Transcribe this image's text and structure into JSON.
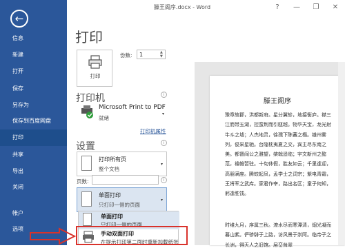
{
  "app": {
    "window_title": "滕王阁序.docx - Word"
  },
  "window_controls": {
    "help": "?",
    "minimize": "—",
    "restore": "❐",
    "close": "✕"
  },
  "sidebar": {
    "back_glyph": "←",
    "items": [
      {
        "label": "信息"
      },
      {
        "label": "新建"
      },
      {
        "label": "打开"
      },
      {
        "label": "保存"
      },
      {
        "label": "另存为"
      },
      {
        "label": "保存到百度网盘"
      },
      {
        "label": "打印"
      },
      {
        "label": "共享"
      },
      {
        "label": "导出"
      },
      {
        "label": "关闭"
      },
      {
        "label": "帐户"
      },
      {
        "label": "选项"
      }
    ],
    "active_index": 6
  },
  "print": {
    "heading": "打印",
    "print_button": "打印",
    "copies_label": "份数:",
    "copies_value": "1"
  },
  "printer": {
    "section_title": "打印机",
    "name": "Microsoft Print to PDF",
    "status": "就绪",
    "properties_link": "打印机属性",
    "info_glyph": "i"
  },
  "settings": {
    "section_title": "设置",
    "range_primary": "打印所有页",
    "range_secondary": "整个文档",
    "pages_label": "页数:",
    "pages_value": "",
    "sides_primary": "单面打印",
    "sides_secondary": "只打印一侧的页面",
    "caret": "▾",
    "info_glyph": "i"
  },
  "sides_menu": {
    "items": [
      {
        "primary": "单面打印",
        "secondary": "只打印一侧的页面"
      },
      {
        "primary": "手动双面打印",
        "secondary": "在提示打印第二面时重新加载纸张"
      }
    ]
  },
  "preview": {
    "title": "滕王阁序",
    "paragraphs": [
      "豫章故郡，洪都新府。星分翼轸，地接衡庐。襟三江而带五湖，控蛮荆而引瓯越。物华天宝，龙光射牛斗之墟；人杰地灵，徐孺下陈蕃之榻。雄州雾列，俊采星驰。台隍枕夷夏之交，宾主尽东南之美。都督阎公之雅望，棨戟遥临；宇文新州之懿范，襜帷暂驻。十旬休假，胜友如云；千里逢迎，高朋满座。腾蛟起凤，孟学士之词宗；紫电青霜，王将军之武库。家君作宰，路出名区；童子何知，躬逢胜饯。",
      "时维九月，序属三秋。潦水尽而寒潭清，烟光凝而暮山紫。俨骖騑于上路，访风景于崇阿。临帝子之长洲，得天人之旧馆。层峦耸翠"
    ]
  },
  "colors": {
    "sidebar_bg": "#2b579a",
    "sidebar_active": "#1e4e8c",
    "highlight_red": "#d9322b",
    "link": "#2b579a"
  }
}
